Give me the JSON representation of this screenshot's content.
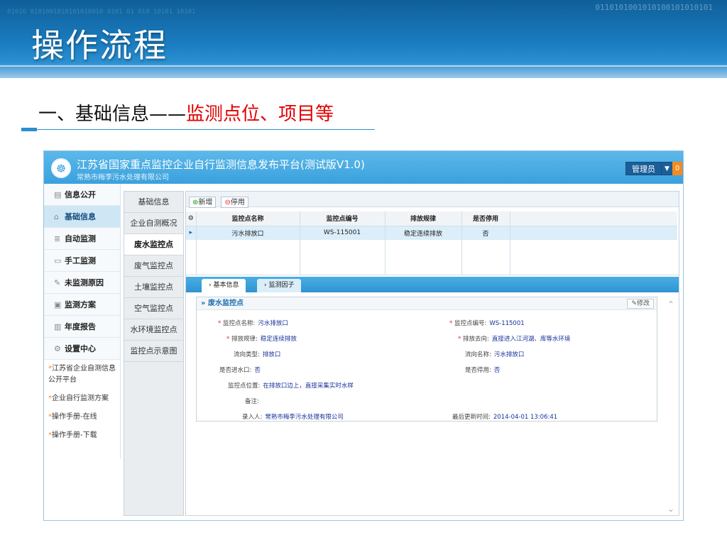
{
  "slide": {
    "title": "操作流程",
    "subtitle_black": "一、基础信息——",
    "subtitle_red": "监测点位、项目等",
    "colors": {
      "header": "#1a7cc0",
      "accent": "#2a8fd0",
      "red": "#e10000"
    }
  },
  "app": {
    "title": "江苏省国家重点监控企业自行监测信息发布平台(测试版V1.0)",
    "subtitle": "常熟市梅李污水处理有限公司",
    "user_label": "管理员",
    "badge_count": "0",
    "logo_icon": "emblem-icon"
  },
  "sidebar": {
    "items": [
      {
        "label": "信息公开",
        "icon": "document-icon"
      },
      {
        "label": "基础信息",
        "icon": "home-icon"
      },
      {
        "label": "自动监测",
        "icon": "list-icon"
      },
      {
        "label": "手工监测",
        "icon": "monitor-icon"
      },
      {
        "label": "未监测原因",
        "icon": "edit-icon"
      },
      {
        "label": "监测方案",
        "icon": "plan-icon"
      },
      {
        "label": "年度报告",
        "icon": "report-icon"
      },
      {
        "label": "设置中心",
        "icon": "gear-icon"
      }
    ],
    "links": [
      "江苏省企业自测信息公开平台",
      "企业自行监测方案",
      "操作手册-在线",
      "操作手册-下载"
    ]
  },
  "subnav": {
    "items": [
      "基础信息",
      "企业自测概况",
      "废水监控点",
      "废气监控点",
      "土壤监控点",
      "空气监控点",
      "水环境监控点",
      "监控点示意图"
    ]
  },
  "toolbar": {
    "add_label": "新增",
    "disable_label": "停用"
  },
  "grid": {
    "headers": [
      "监控点名称",
      "监控点编号",
      "排放规律",
      "是否停用"
    ],
    "rows": [
      {
        "name": "污水排放口",
        "code": "WS-115001",
        "rule": "稳定连续排放",
        "disabled": "否"
      }
    ]
  },
  "tabs": [
    "基本信息",
    "监测因子"
  ],
  "detail": {
    "section_title": "废水监控点",
    "edit_label": "修改",
    "fields": {
      "name_label": "监控点名称:",
      "name_value": "污水排放口",
      "code_label": "监控点编号:",
      "code_value": "WS-115001",
      "rule_label": "排放规律:",
      "rule_value": "稳定连续排放",
      "dest_label": "排放去向:",
      "dest_value": "直接进入江河湖、库等水环境",
      "flow_label": "流向类型:",
      "flow_value": "排放口",
      "flowname_label": "流向名称:",
      "flowname_value": "污水排放口",
      "inlet_label": "是否进水口:",
      "inlet_value": "否",
      "stop_label": "是否停用:",
      "stop_value": "否",
      "loc_label": "监控点位置:",
      "loc_value": "在排放口边上，直接采集实时水样",
      "note_label": "备注:",
      "note_value": "",
      "entry_label": "录入人:",
      "entry_value": "常熟市梅李污水处理有限公司",
      "update_label": "最后更新时间:",
      "update_value": "2014-04-01 13:06:41"
    }
  }
}
